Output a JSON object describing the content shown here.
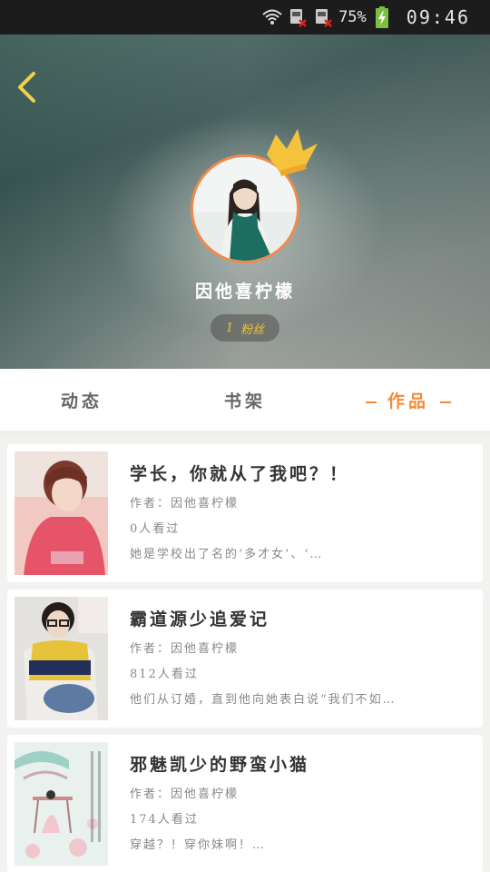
{
  "status_bar": {
    "battery": "75%",
    "time": "09:46",
    "icons": [
      "wifi-icon",
      "sim1-no-signal-icon",
      "sim2-no-signal-icon",
      "battery-charging-icon"
    ]
  },
  "profile": {
    "nickname": "因他喜柠檬",
    "fans_count": "1",
    "fans_label": "粉丝",
    "back_icon": "chevron-left-icon",
    "crown_icon": "crown-icon"
  },
  "tabs": [
    {
      "label": "动态"
    },
    {
      "label": "书架"
    },
    {
      "label": "作品"
    }
  ],
  "colors": {
    "accent": "#f28c3d",
    "fans_text": "#f3c52f"
  },
  "works": [
    {
      "title": "学长，你就从了我吧？！",
      "author": "作者：因他喜柠檬",
      "views": "0人看过",
      "desc": "她是学校出了名的‘多才女’、‘…"
    },
    {
      "title": "霸道源少追爱记",
      "author": "作者：因他喜柠檬",
      "views": "812人看过",
      "desc": "他们从订婚，直到他向她表白说“我们不如…"
    },
    {
      "title": "邪魅凯少的野蛮小猫",
      "author": "作者：因他喜柠檬",
      "views": "174人看过",
      "desc": "穿越？！穿你妹啊！…"
    }
  ]
}
